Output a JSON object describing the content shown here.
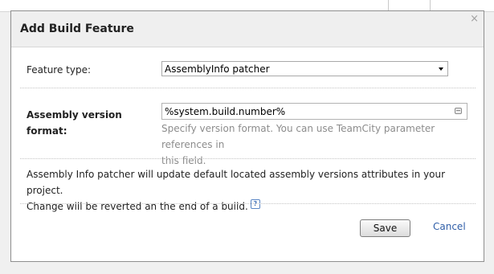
{
  "dialog": {
    "title": "Add Build Feature",
    "close_glyph": "×"
  },
  "feature_type": {
    "label": "Feature type:",
    "selected": "AssemblyInfo patcher"
  },
  "version_format": {
    "label_line1": "Assembly version",
    "label_line2": "format:",
    "value": "%system.build.number%",
    "hint_line1": "Specify version format. You can use TeamCity parameter references in",
    "hint_line2": "this field."
  },
  "info": {
    "line1": "Assembly Info patcher will update default located assembly versions attributes in your project.",
    "line2": "Change will be reverted an the end of a build.",
    "help_glyph": "?"
  },
  "actions": {
    "save_label": "Save",
    "cancel_label": "Cancel"
  },
  "icons": {
    "close": "close-icon",
    "dropdown": "chevron-down-icon",
    "parameter_picker": "parameter-picker-icon",
    "help": "help-icon"
  }
}
